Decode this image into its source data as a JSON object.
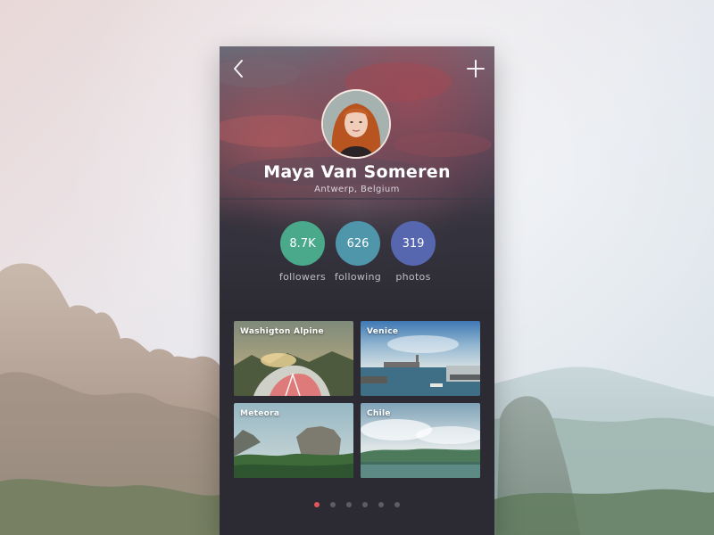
{
  "profile": {
    "name": "Maya Van Someren",
    "location": "Antwerp, Belgium"
  },
  "header": {
    "back_icon": "chevron-left-icon",
    "add_icon": "plus-icon"
  },
  "stats": [
    {
      "value": "8.7K",
      "label": "followers",
      "color": "#4aa98a"
    },
    {
      "value": "626",
      "label": "following",
      "color": "#4f96ab"
    },
    {
      "value": "319",
      "label": "photos",
      "color": "#5667b0"
    }
  ],
  "albums": [
    {
      "title": "Washigton Alpine"
    },
    {
      "title": "Venice"
    },
    {
      "title": "Meteora"
    },
    {
      "title": "Chile"
    }
  ],
  "pagination": {
    "active_color": "#e0565b",
    "inactive_color": "#5d5c68",
    "active_index": 0,
    "count": 6
  }
}
